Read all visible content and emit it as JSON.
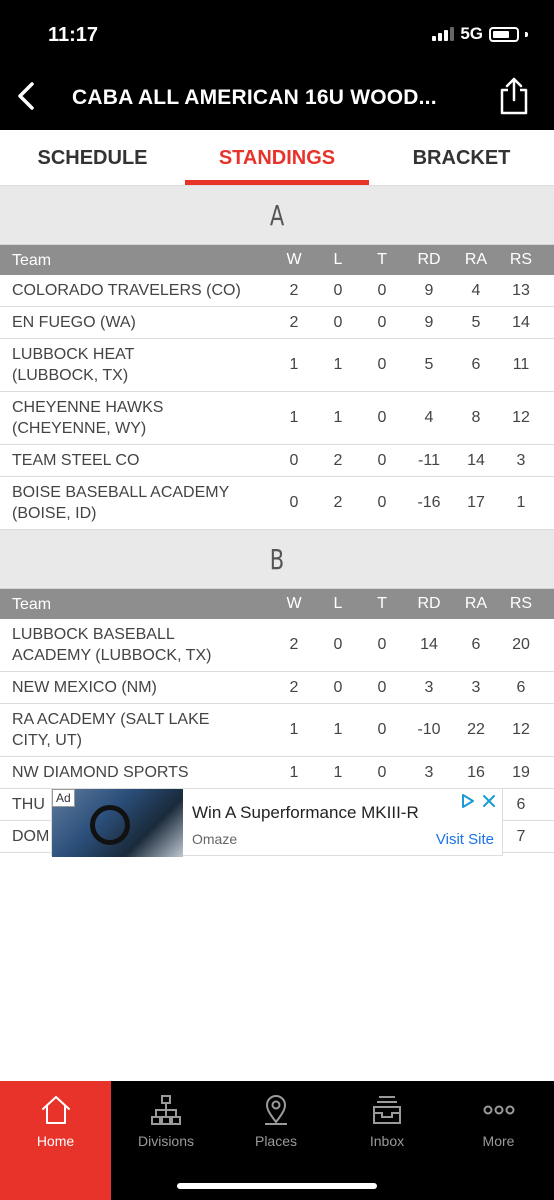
{
  "status_bar": {
    "time": "11:17",
    "network": "5G"
  },
  "nav": {
    "title": "CABA ALL AMERICAN 16U WOOD..."
  },
  "tabs": [
    {
      "label": "SCHEDULE",
      "active": false
    },
    {
      "label": "STANDINGS",
      "active": true
    },
    {
      "label": "BRACKET",
      "active": false
    }
  ],
  "columns": [
    "Team",
    "W",
    "L",
    "T",
    "RD",
    "RA",
    "RS"
  ],
  "groups": [
    {
      "name": "A",
      "rows": [
        {
          "team": "COLORADO TRAVELERS (CO)",
          "w": "2",
          "l": "0",
          "t": "0",
          "rd": "9",
          "ra": "4",
          "rs": "13"
        },
        {
          "team": "EN FUEGO (WA)",
          "w": "2",
          "l": "0",
          "t": "0",
          "rd": "9",
          "ra": "5",
          "rs": "14"
        },
        {
          "team": "LUBBOCK HEAT (LUBBOCK, TX)",
          "w": "1",
          "l": "1",
          "t": "0",
          "rd": "5",
          "ra": "6",
          "rs": "11"
        },
        {
          "team": "CHEYENNE HAWKS (CHEYENNE, WY)",
          "w": "1",
          "l": "1",
          "t": "0",
          "rd": "4",
          "ra": "8",
          "rs": "12"
        },
        {
          "team": "TEAM STEEL CO",
          "w": "0",
          "l": "2",
          "t": "0",
          "rd": "-11",
          "ra": "14",
          "rs": "3"
        },
        {
          "team": "BOISE BASEBALL ACADEMY (BOISE, ID)",
          "w": "0",
          "l": "2",
          "t": "0",
          "rd": "-16",
          "ra": "17",
          "rs": "1"
        }
      ]
    },
    {
      "name": "B",
      "rows": [
        {
          "team": "LUBBOCK BASEBALL ACADEMY (LUBBOCK, TX)",
          "w": "2",
          "l": "0",
          "t": "0",
          "rd": "14",
          "ra": "6",
          "rs": "20"
        },
        {
          "team": "NEW MEXICO (NM)",
          "w": "2",
          "l": "0",
          "t": "0",
          "rd": "3",
          "ra": "3",
          "rs": "6"
        },
        {
          "team": "RA ACADEMY (SALT LAKE CITY, UT)",
          "w": "1",
          "l": "1",
          "t": "0",
          "rd": "-10",
          "ra": "22",
          "rs": "12"
        },
        {
          "team": "NW DIAMOND SPORTS",
          "w": "1",
          "l": "1",
          "t": "0",
          "rd": "3",
          "ra": "16",
          "rs": "19"
        },
        {
          "team": "THU",
          "w": "",
          "l": "",
          "t": "",
          "rd": "",
          "ra": "",
          "rs": "6"
        },
        {
          "team": "DOM",
          "w": "",
          "l": "",
          "t": "",
          "rd": "",
          "ra": "",
          "rs": "7"
        }
      ]
    }
  ],
  "ad": {
    "badge": "Ad",
    "title": "Win A Superformance MKIII-R",
    "source": "Omaze",
    "cta": "Visit Site"
  },
  "tabbar": [
    {
      "label": "Home",
      "icon": "home-icon",
      "active": true
    },
    {
      "label": "Divisions",
      "icon": "bracket-tree-icon",
      "active": false
    },
    {
      "label": "Places",
      "icon": "map-pin-icon",
      "active": false
    },
    {
      "label": "Inbox",
      "icon": "inbox-icon",
      "active": false
    },
    {
      "label": "More",
      "icon": "more-dots-icon",
      "active": false
    }
  ],
  "colors": {
    "accent": "#e8332a",
    "header_gray": "#8e8e8e",
    "group_bg": "#e9e9e9"
  }
}
